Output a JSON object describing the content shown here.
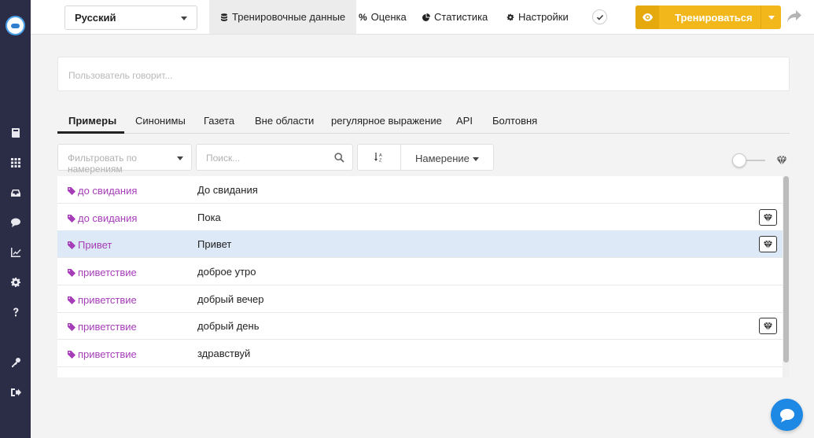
{
  "sidebar": {
    "items": [
      {
        "icon": "book-icon"
      },
      {
        "icon": "grid-icon"
      },
      {
        "icon": "inbox-icon"
      },
      {
        "icon": "chat-icon"
      },
      {
        "icon": "chart-icon"
      },
      {
        "icon": "gear-icon"
      },
      {
        "icon": "help-icon"
      },
      {
        "icon": "key-icon"
      },
      {
        "icon": "logout-icon"
      }
    ]
  },
  "topbar": {
    "language": "Русский",
    "tabs": [
      {
        "label": "Тренировочные данные",
        "icon": "database-icon",
        "active": true
      },
      {
        "label": "Оценка",
        "icon": "percent-icon",
        "active": false
      },
      {
        "label": "Статистика",
        "icon": "pie-chart-icon",
        "active": false
      },
      {
        "label": "Настройки",
        "icon": "gear-icon",
        "active": false
      }
    ],
    "train_label": "Тренироваться"
  },
  "utterance": {
    "placeholder": "Пользователь говорит..."
  },
  "subtabs": [
    {
      "label": "Примеры",
      "active": true
    },
    {
      "label": "Синонимы",
      "active": false
    },
    {
      "label": "Газета",
      "active": false
    },
    {
      "label": "Вне области",
      "active": false
    },
    {
      "label": "регулярное выражение",
      "active": false
    },
    {
      "label": "API",
      "active": false
    },
    {
      "label": "Болтовня",
      "active": false
    }
  ],
  "filters": {
    "intent_filter_placeholder": "Фильтровать по намерениям",
    "search_placeholder": "Поиск...",
    "sort_by": "Намерение"
  },
  "examples": [
    {
      "intent": "до свидания",
      "text": "До свидания",
      "selected": false,
      "gem": false
    },
    {
      "intent": "до свидания",
      "text": "Пока",
      "selected": false,
      "gem": true
    },
    {
      "intent": "Привет",
      "text": "Привет",
      "selected": true,
      "gem": true
    },
    {
      "intent": "приветствие",
      "text": "доброе утро",
      "selected": false,
      "gem": false
    },
    {
      "intent": "приветствие",
      "text": "добрый вечер",
      "selected": false,
      "gem": false
    },
    {
      "intent": "приветствие",
      "text": "добрый день",
      "selected": false,
      "gem": true
    },
    {
      "intent": "приветствие",
      "text": "здравствуй",
      "selected": false,
      "gem": false
    }
  ],
  "colors": {
    "sidebar": "#2b2d47",
    "accent": "#f2b81b",
    "intent": "#a63db8",
    "selected_row": "#dde9f6",
    "chat": "#1e88e5"
  }
}
